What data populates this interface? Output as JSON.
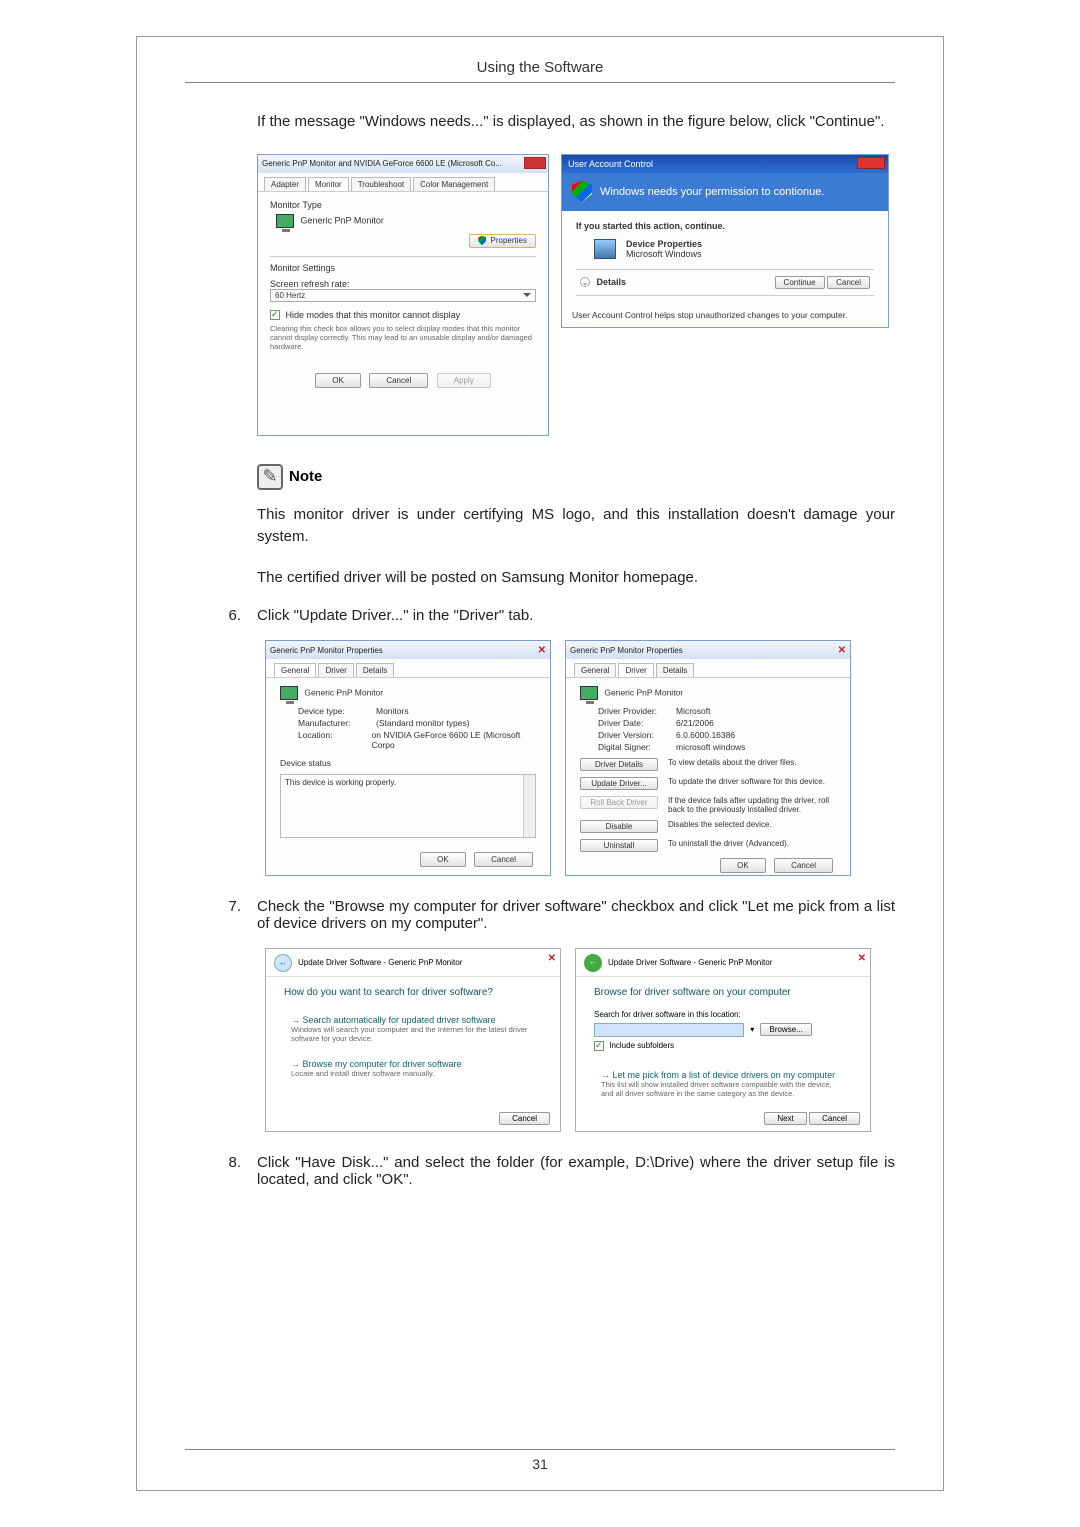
{
  "header": "Using the Software",
  "intro": "If the message \"Windows needs...\" is displayed, as shown in the figure below, click \"Continue\".",
  "fig1_left": {
    "title": "Generic PnP Monitor and NVIDIA GeForce 6600 LE (Microsoft Co...",
    "tabs": [
      "Adapter",
      "Monitor",
      "Troubleshoot",
      "Color Management"
    ],
    "monitor_type_label": "Monitor Type",
    "monitor_name": "Generic PnP Monitor",
    "properties_btn": "Properties",
    "monitor_settings_label": "Monitor Settings",
    "refresh_label": "Screen refresh rate:",
    "refresh_value": "60 Hertz",
    "hide_modes_label": "Hide modes that this monitor cannot display",
    "hide_modes_desc": "Clearing this check box allows you to select display modes that this monitor cannot display correctly. This may lead to an unusable display and/or damaged hardware.",
    "ok": "OK",
    "cancel": "Cancel",
    "apply": "Apply"
  },
  "fig1_right": {
    "title": "User Account Control",
    "banner": "Windows needs your permission to contionue.",
    "started": "If you started this action, continue.",
    "app_name": "Device Properties",
    "publisher": "Microsoft Windows",
    "details": "Details",
    "continue": "Continue",
    "cancel": "Cancel",
    "helps": "User Account Control helps stop unauthorized changes to your computer."
  },
  "note_label": "Note",
  "note_p1": "This monitor driver is under certifying MS logo, and this installation doesn't damage your system.",
  "note_p2": "The certified driver will be posted on Samsung Monitor homepage.",
  "step6": {
    "num": "6.",
    "text": "Click \"Update Driver...\" in the \"Driver\" tab."
  },
  "fig2_left": {
    "title": "Generic PnP Monitor Properties",
    "tabs": [
      "General",
      "Driver",
      "Details"
    ],
    "monitor_name": "Generic PnP Monitor",
    "device_type_k": "Device type:",
    "device_type_v": "Monitors",
    "manufacturer_k": "Manufacturer:",
    "manufacturer_v": "(Standard monitor types)",
    "location_k": "Location:",
    "location_v": "on NVIDIA GeForce 6600 LE (Microsoft Corpo",
    "device_status_label": "Device status",
    "device_status_text": "This device is working properly.",
    "ok": "OK",
    "cancel": "Cancel"
  },
  "fig2_right": {
    "title": "Generic PnP Monitor Properties",
    "tabs": [
      "General",
      "Driver",
      "Details"
    ],
    "monitor_name": "Generic PnP Monitor",
    "provider_k": "Driver Provider:",
    "provider_v": "Microsoft",
    "date_k": "Driver Date:",
    "date_v": "6/21/2006",
    "version_k": "Driver Version:",
    "version_v": "6.0.6000.16386",
    "signer_k": "Digital Signer:",
    "signer_v": "microsoft windows",
    "details_btn": "Driver Details",
    "details_desc": "To view details about the driver files.",
    "update_btn": "Update Driver...",
    "update_desc": "To update the driver software for this device.",
    "rollback_btn": "Roll Back Driver",
    "rollback_desc": "If the device fails after updating the driver, roll back to the previously installed driver.",
    "disable_btn": "Disable",
    "disable_desc": "Disables the selected device.",
    "uninstall_btn": "Uninstall",
    "uninstall_desc": "To uninstall the driver (Advanced).",
    "ok": "OK",
    "cancel": "Cancel"
  },
  "step7": {
    "num": "7.",
    "text": "Check the \"Browse my computer for driver software\" checkbox and click \"Let me pick from a list of device drivers on my computer\"."
  },
  "fig3_left": {
    "breadcrumb": "Update Driver Software - Generic PnP Monitor",
    "heading": "How do you want to search for driver software?",
    "opt1_t": "Search automatically for updated driver software",
    "opt1_d": "Windows will search your computer and the Internet for the latest driver software for your device.",
    "opt2_t": "Browse my computer for driver software",
    "opt2_d": "Locate and install driver software manually.",
    "cancel": "Cancel"
  },
  "fig3_right": {
    "breadcrumb": "Update Driver Software - Generic PnP Monitor",
    "heading": "Browse for driver software on your computer",
    "search_label": "Search for driver software in this location:",
    "browse": "Browse...",
    "include": "Include subfolders",
    "opt_t": "Let me pick from a list of device drivers on my computer",
    "opt_d": "This list will show installed driver software compatible with the device, and all driver software in the same category as the device.",
    "next": "Next",
    "cancel": "Cancel"
  },
  "step8": {
    "num": "8.",
    "text": "Click \"Have Disk...\" and select the folder (for example, D:\\Drive) where the driver setup file is located, and click \"OK\"."
  },
  "page_number": "31"
}
